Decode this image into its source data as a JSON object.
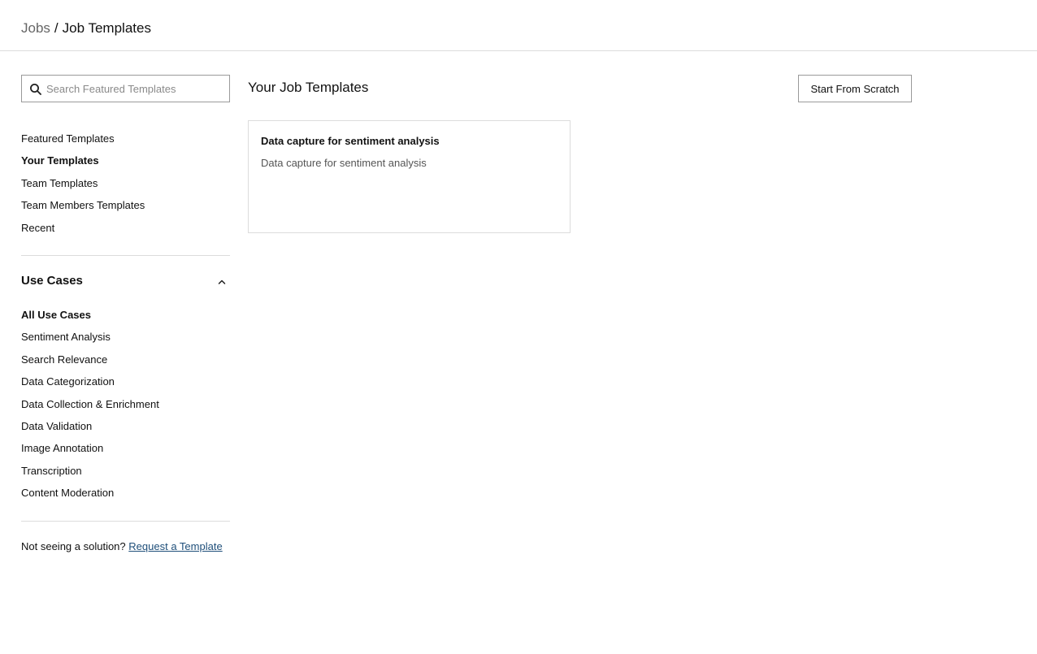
{
  "breadcrumb": {
    "parent": "Jobs",
    "separator": "/",
    "current": "Job Templates"
  },
  "search": {
    "placeholder": "Search Featured Templates",
    "value": "",
    "icon": "search-icon"
  },
  "nav": {
    "items": [
      {
        "label": "Featured Templates",
        "active": false
      },
      {
        "label": "Your Templates",
        "active": true
      },
      {
        "label": "Team Templates",
        "active": false
      },
      {
        "label": "Team Members Templates",
        "active": false
      },
      {
        "label": "Recent",
        "active": false
      }
    ]
  },
  "use_cases": {
    "title": "Use Cases",
    "expanded": true,
    "toggle_icon": "chevron-up-icon",
    "items": [
      {
        "label": "All Use Cases",
        "active": true
      },
      {
        "label": "Sentiment Analysis",
        "active": false
      },
      {
        "label": "Search Relevance",
        "active": false
      },
      {
        "label": "Data Categorization",
        "active": false
      },
      {
        "label": "Data Collection & Enrichment",
        "active": false
      },
      {
        "label": "Data Validation",
        "active": false
      },
      {
        "label": "Image Annotation",
        "active": false
      },
      {
        "label": "Transcription",
        "active": false
      },
      {
        "label": "Content Moderation",
        "active": false
      }
    ]
  },
  "footer": {
    "prompt": "Not seeing a solution?",
    "link_label": "Request a Template"
  },
  "main": {
    "title": "Your Job Templates",
    "scratch_button_label": "Start From Scratch",
    "templates": [
      {
        "title": "Data capture for sentiment analysis",
        "description": "Data capture for sentiment analysis"
      }
    ]
  },
  "colors": {
    "link": "#1f4f7a",
    "border": "#dcdcdc",
    "muted_text": "#666666"
  }
}
